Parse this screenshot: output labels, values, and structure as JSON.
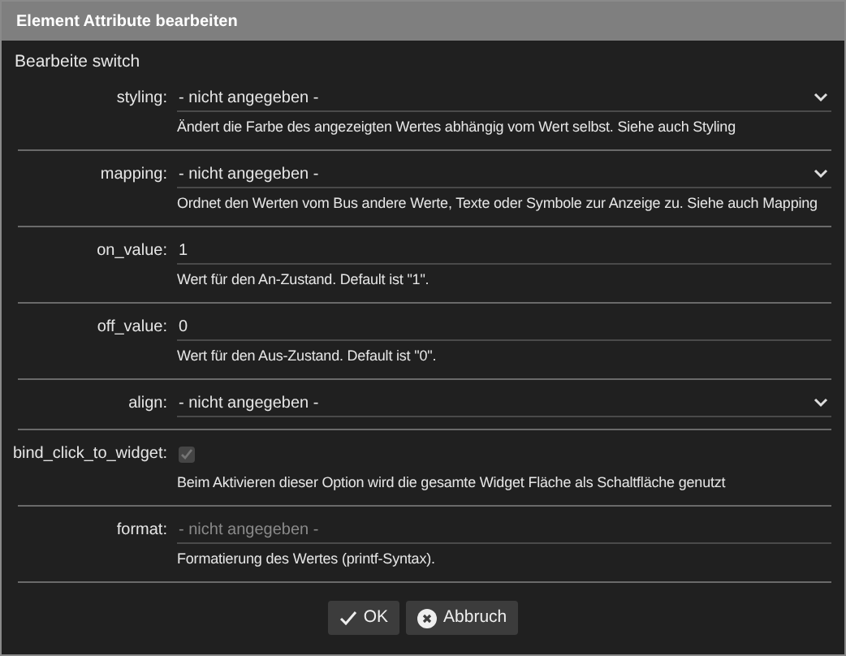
{
  "window": {
    "title": "Element Attribute bearbeiten"
  },
  "heading": "Bearbeite switch",
  "attributes": [
    {
      "kind": "select",
      "label": "styling:",
      "value": "- nicht angegeben -",
      "description": "Ändert die Farbe des angezeigten Wertes abhängig vom Wert selbst. Siehe auch Styling"
    },
    {
      "kind": "select",
      "label": "mapping:",
      "value": "- nicht angegeben -",
      "description": "Ordnet den Werten vom Bus andere Werte, Texte oder Symbole zur Anzeige zu. Siehe auch Mapping"
    },
    {
      "kind": "text",
      "label": "on_value:",
      "value": "1",
      "description": "Wert für den An-Zustand. Default ist \"1\"."
    },
    {
      "kind": "text",
      "label": "off_value:",
      "value": "0",
      "description": "Wert für den Aus-Zustand. Default ist \"0\"."
    },
    {
      "kind": "select",
      "label": "align:",
      "value": "- nicht angegeben -"
    },
    {
      "kind": "checkbox",
      "label": "bind_click_to_widget:",
      "checked": true,
      "disabled": true,
      "description": "Beim Aktivieren dieser Option wird die gesamte Widget Fläche als Schaltfläche genutzt"
    },
    {
      "kind": "text",
      "label": "format:",
      "placeholder": "- nicht angegeben -",
      "description": "Formatierung des Wertes (printf-Syntax)."
    }
  ],
  "buttons": [
    {
      "kind": "ok",
      "label": "OK"
    },
    {
      "kind": "cancel",
      "label": "Abbruch"
    }
  ]
}
